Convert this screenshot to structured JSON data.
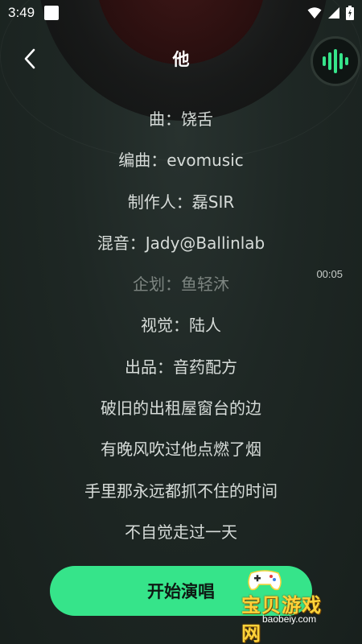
{
  "status_bar": {
    "time": "3:49"
  },
  "header": {
    "title": "他"
  },
  "lyrics": [
    {
      "text": "曲：饶舌",
      "dim": false
    },
    {
      "text": "编曲：evomusic",
      "dim": false
    },
    {
      "text": "制作人：磊SIR",
      "dim": false
    },
    {
      "text": "混音：Jady@Ballinlab",
      "dim": false
    },
    {
      "text": "企划：鱼轻沐",
      "dim": true
    },
    {
      "text": "视觉：陆人",
      "dim": false
    },
    {
      "text": "出品：音药配方",
      "dim": false
    },
    {
      "text": "破旧的出租屋窗台的边",
      "dim": false
    },
    {
      "text": "有晚风吹过他点燃了烟",
      "dim": false
    },
    {
      "text": "手里那永远都抓不住的时间",
      "dim": false
    },
    {
      "text": "不自觉走过一天",
      "dim": false
    }
  ],
  "timestamp": "00:05",
  "start_button": {
    "label": "开始演唱"
  },
  "watermark": {
    "main": "宝贝游戏网",
    "sub": "baobeiy.com"
  },
  "icons": {
    "back": "back-chevron-icon",
    "voice": "sound-wave-icon",
    "wifi": "wifi-icon",
    "signal": "signal-icon",
    "battery": "battery-icon"
  },
  "colors": {
    "accent": "#36e48a",
    "background": "#1b2421",
    "text": "#d7dcd9",
    "text_dim": "#7d8581"
  }
}
